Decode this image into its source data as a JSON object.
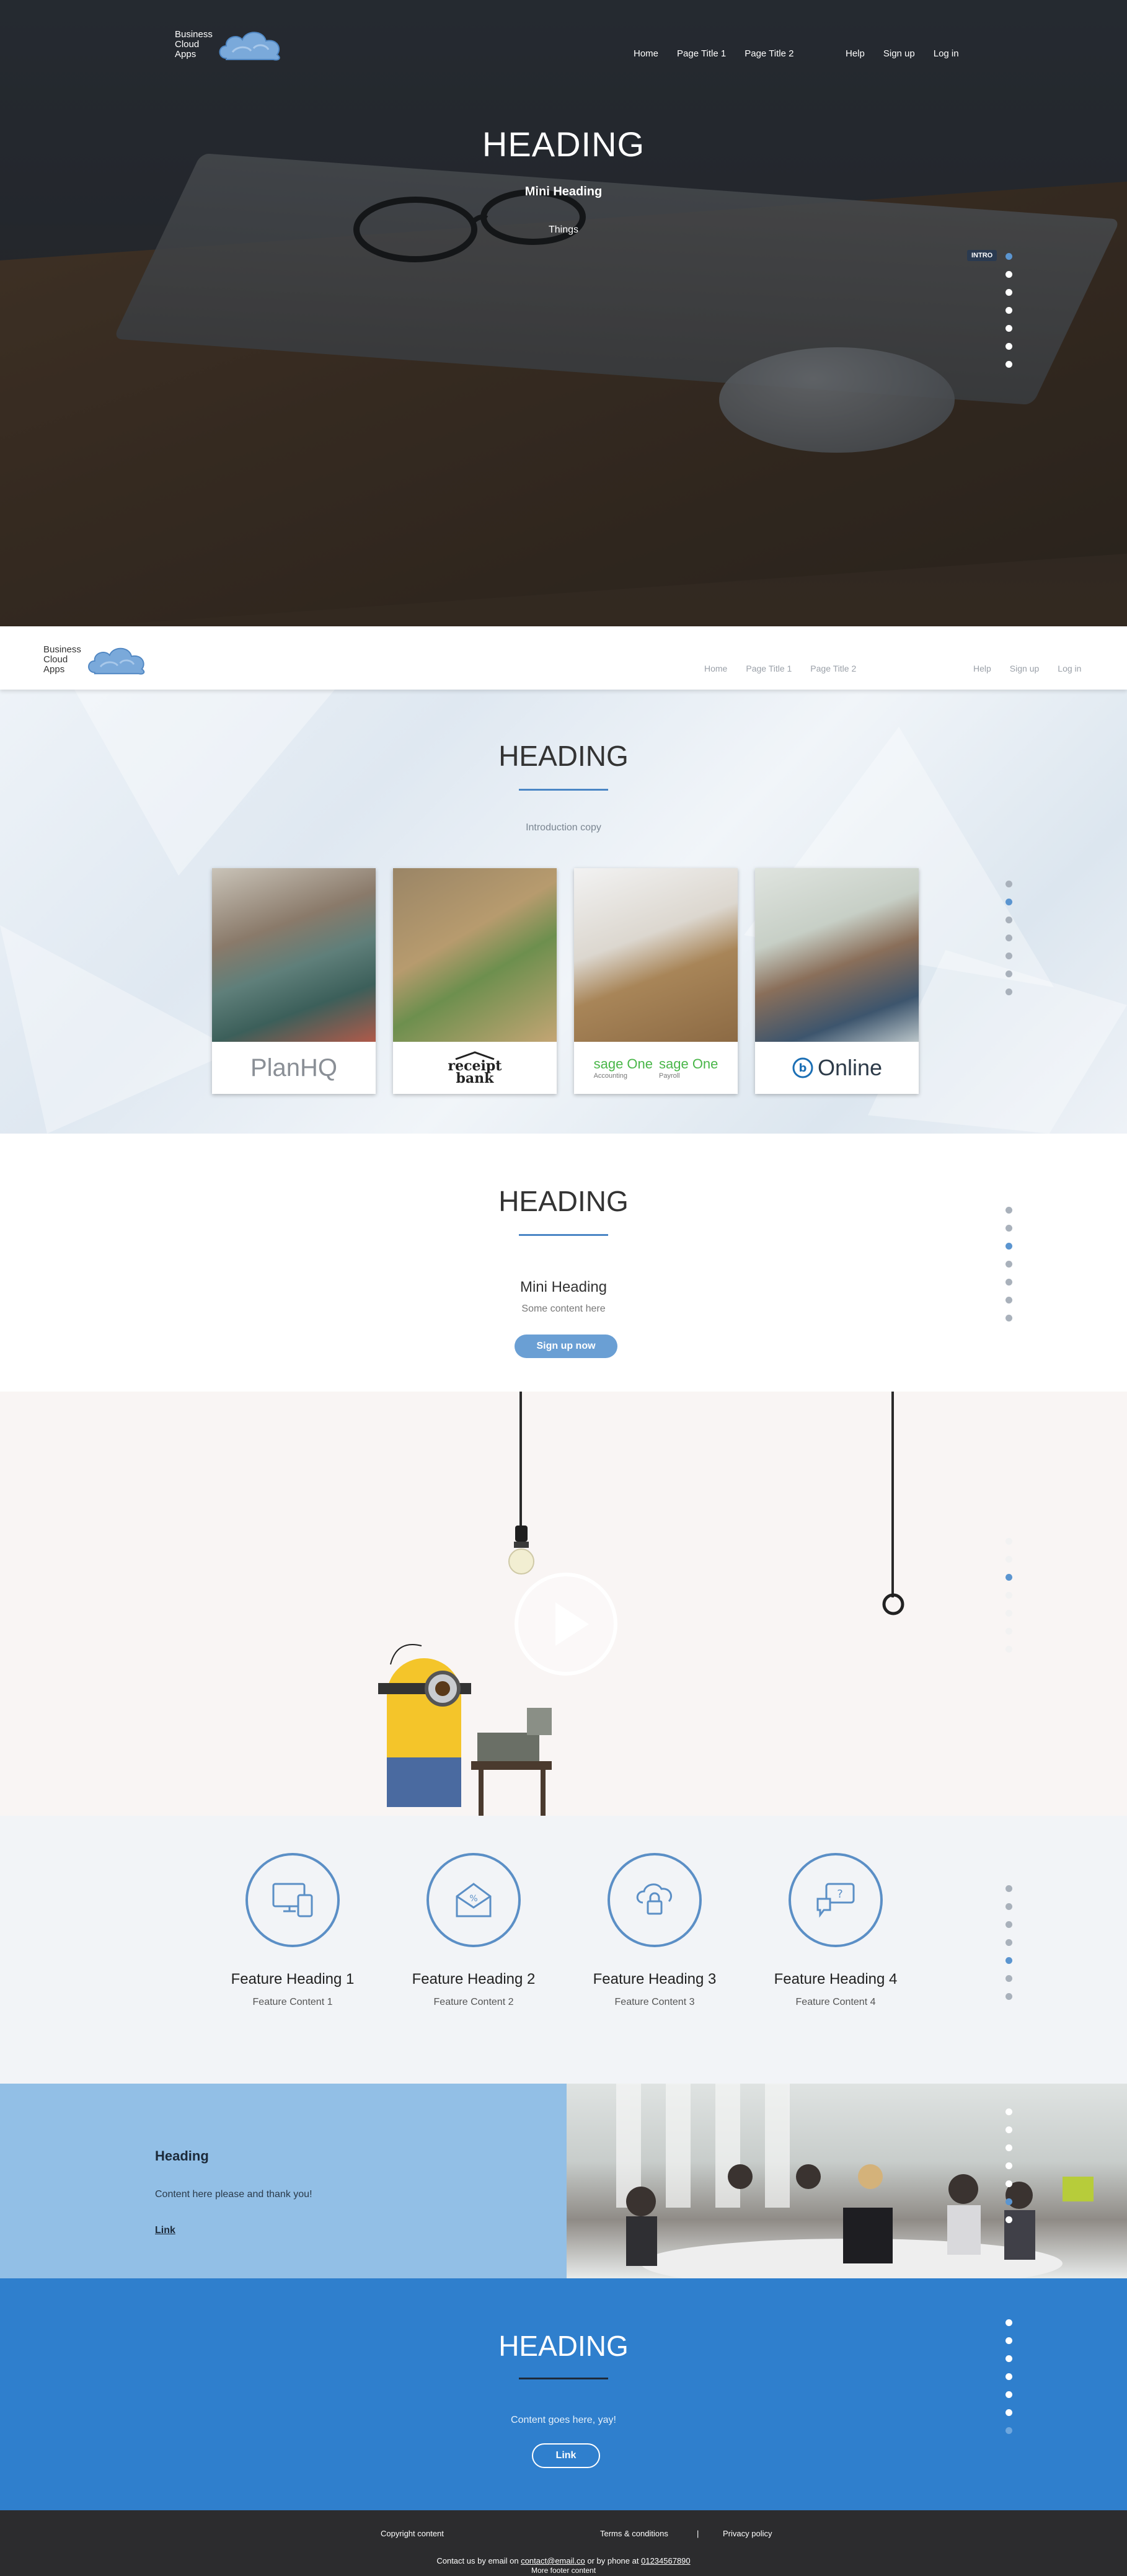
{
  "brand": {
    "line1": "Business",
    "line2": "Cloud",
    "line3": "Apps"
  },
  "nav": {
    "left": [
      "Home",
      "Page Title 1",
      "Page Title 2"
    ],
    "right": [
      "Help",
      "Sign up",
      "Log in"
    ]
  },
  "hero": {
    "heading": "HEADING",
    "mini_heading": "Mini Heading",
    "subtext": "Things",
    "tag": "INTRO"
  },
  "products": {
    "heading": "HEADING",
    "intro": "Introduction copy",
    "cards": [
      {
        "name": "PlanHQ"
      },
      {
        "name": "receipt bank"
      },
      {
        "name": "sage One",
        "sub1": "Accounting",
        "name2": "sage One",
        "sub2": "Payroll"
      },
      {
        "name": "Online"
      }
    ]
  },
  "signup": {
    "heading": "HEADING",
    "mini_heading": "Mini Heading",
    "content": "Some content here",
    "button": "Sign up now"
  },
  "features": [
    {
      "title": "Feature Heading 1",
      "content": "Feature Content 1",
      "icon": "devices-icon"
    },
    {
      "title": "Feature Heading 2",
      "content": "Feature Content 2",
      "icon": "envelope-percent-icon"
    },
    {
      "title": "Feature Heading 3",
      "content": "Feature Content 3",
      "icon": "cloud-lock-icon"
    },
    {
      "title": "Feature Heading 4",
      "content": "Feature Content 4",
      "icon": "chat-question-icon"
    }
  ],
  "split": {
    "heading": "Heading",
    "content": "Content here please and thank you!",
    "link": "Link"
  },
  "blue": {
    "heading": "HEADING",
    "content": "Content goes here, yay!",
    "link": "Link"
  },
  "footer": {
    "copyright": "Copyright content",
    "terms": "Terms & conditions",
    "separator": "|",
    "privacy": "Privacy policy",
    "contact_prefix": "Contact us by email on",
    "email": "contact@email.co",
    "contact_mid": "or by phone at",
    "phone": "01234567890",
    "more": "More footer content"
  },
  "colors": {
    "accent": "#4a86c5",
    "blue_section": "#2f7fcd",
    "split_left": "#92bfe6",
    "footer": "#2c2c2e"
  }
}
